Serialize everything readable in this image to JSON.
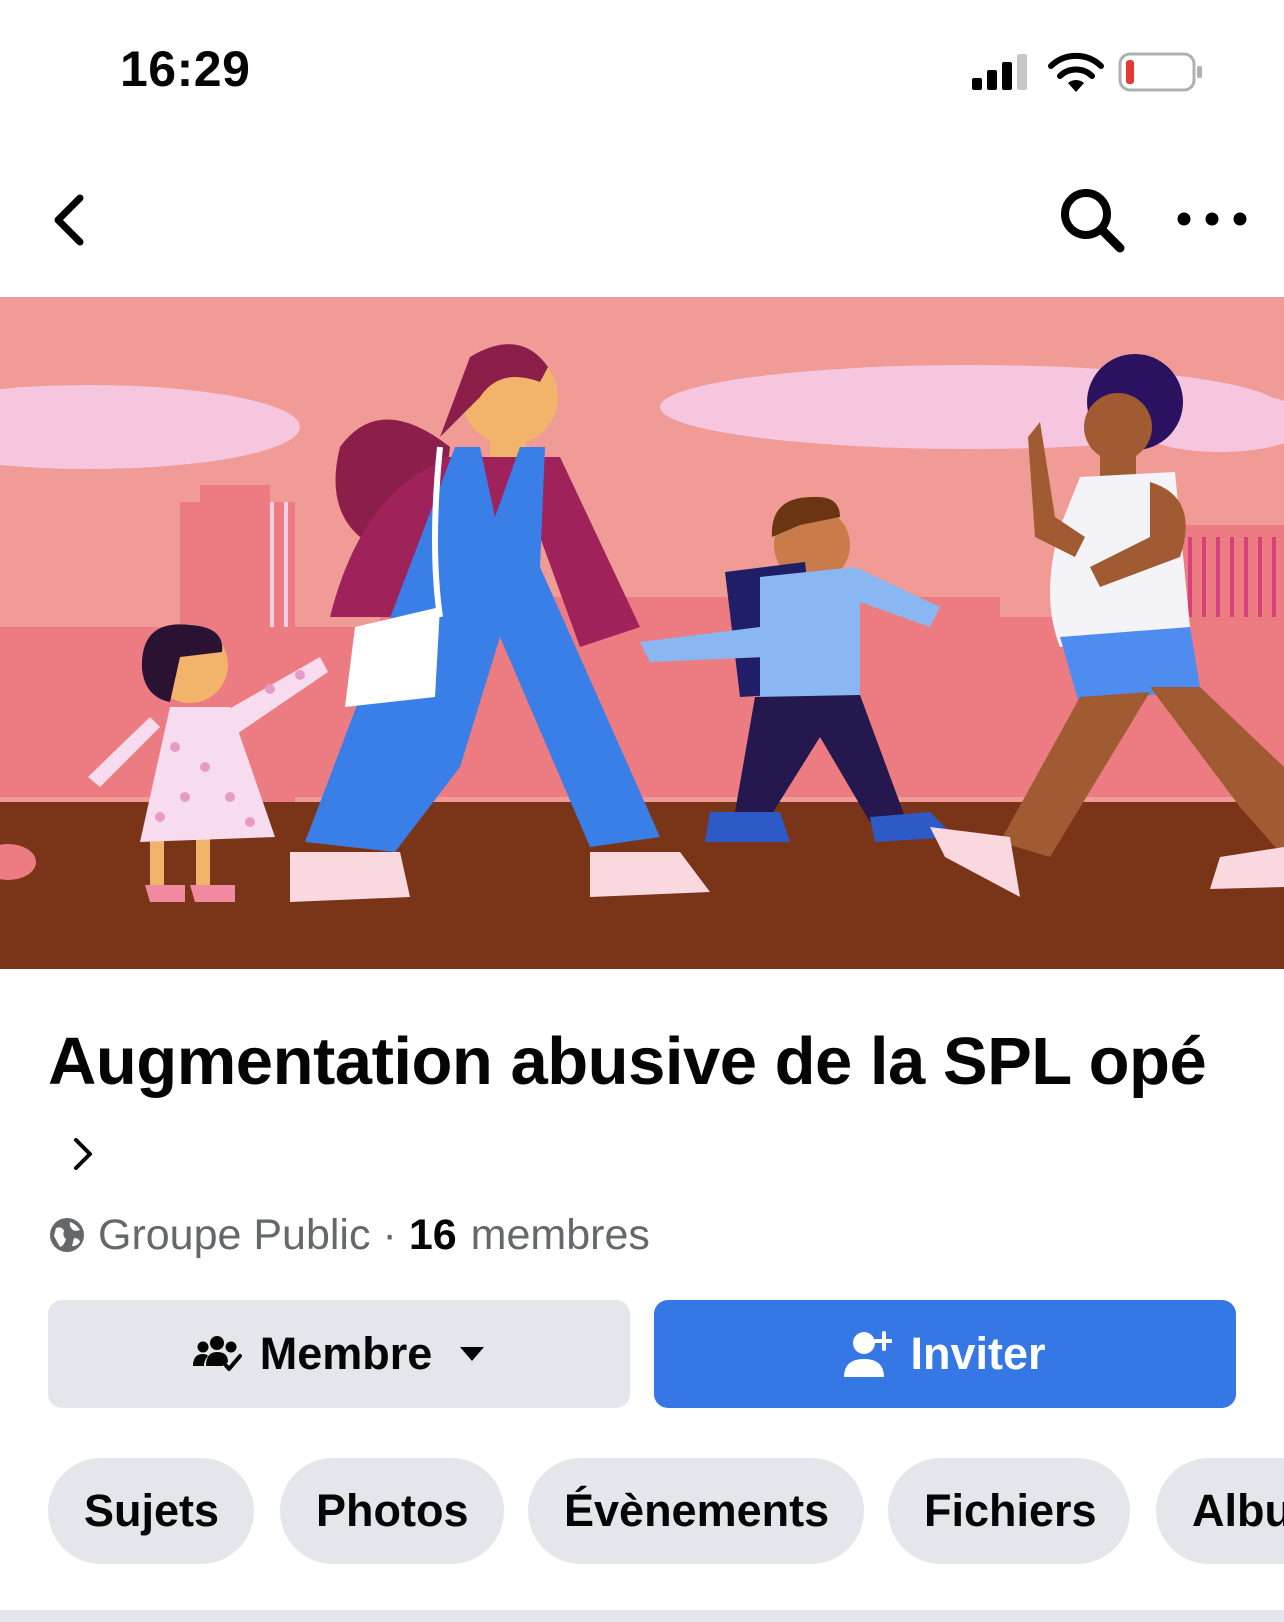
{
  "status_bar": {
    "time": "16:29",
    "icons": [
      "cellular-signal-icon",
      "wifi-icon",
      "battery-low-icon"
    ],
    "battery_color": "#e53935"
  },
  "nav": {
    "icons": [
      "back-chevron-icon",
      "search-icon",
      "more-options-icon"
    ]
  },
  "cover": {
    "description_icon": "cover-illustration",
    "colors": {
      "sky": "#f09b95",
      "ground": "#7a3418"
    }
  },
  "group": {
    "title": "Augmentation abusive de la SPL opé",
    "privacy": "Groupe Public",
    "separator": "·",
    "member_count": "16",
    "member_label": "membres"
  },
  "actions": {
    "member_label": "Membre",
    "invite_label": "Inviter",
    "accent_color": "#3578e5"
  },
  "tabs": [
    {
      "label": "Sujets"
    },
    {
      "label": "Photos"
    },
    {
      "label": "Évènements"
    },
    {
      "label": "Fichiers"
    },
    {
      "label": "Albu"
    }
  ]
}
